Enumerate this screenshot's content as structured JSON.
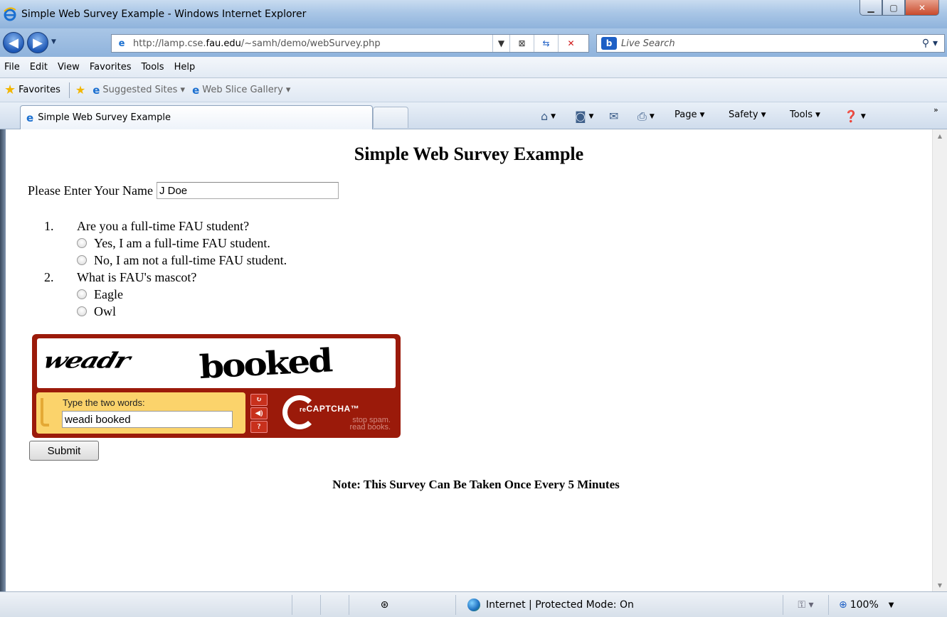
{
  "window": {
    "title": "Simple Web Survey Example - Windows Internet Explorer"
  },
  "nav": {
    "url_prefix": "http://lamp.cse.",
    "url_domain": "fau.edu",
    "url_suffix": "/~samh/demo/webSurvey.php",
    "search_placeholder": "Live Search"
  },
  "menu": {
    "items": [
      "File",
      "Edit",
      "View",
      "Favorites",
      "Tools",
      "Help"
    ]
  },
  "favorites": {
    "label": "Favorites",
    "links": [
      "Suggested Sites",
      "Web Slice Gallery"
    ]
  },
  "tabs": {
    "active_tab": "Simple Web Survey Example"
  },
  "command_bar": {
    "page": "Page",
    "safety": "Safety",
    "tools": "Tools"
  },
  "page": {
    "title": "Simple Web Survey Example",
    "name_label": "Please Enter Your Name",
    "name_value": "J Doe",
    "questions": [
      {
        "number": "1.",
        "text": "Are you a full-time FAU student?",
        "options": [
          "Yes, I am a full-time FAU student.",
          "No, I am not a full-time FAU student."
        ]
      },
      {
        "number": "2.",
        "text": "What is FAU's mascot?",
        "options": [
          "Eagle",
          "Owl"
        ]
      }
    ],
    "captcha": {
      "word1": "weadr",
      "word2": "booked",
      "prompt": "Type the two words:",
      "value": "weadi booked",
      "brand_prefix": "re",
      "brand": "CAPTCHA",
      "tagline1": "stop spam.",
      "tagline2": "read books."
    },
    "submit_label": "Submit",
    "note": "Note: This Survey Can Be Taken Once Every 5 Minutes"
  },
  "status": {
    "zone": "Internet | Protected Mode: On",
    "zoom": "100%"
  }
}
